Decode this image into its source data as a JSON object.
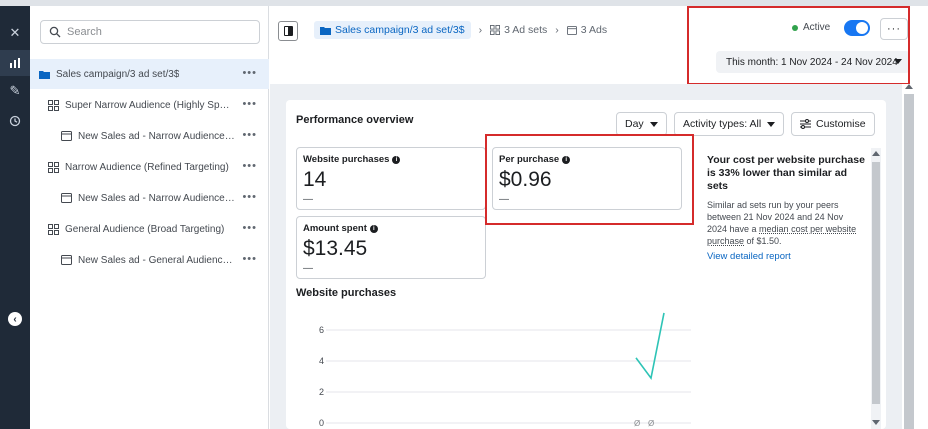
{
  "search": {
    "placeholder": "Search"
  },
  "tree": [
    {
      "label": "Sales campaign/3 ad set/3$",
      "type": "campaign",
      "selected": true
    },
    {
      "label": "Super Narrow Audience (Highly Specifi...",
      "type": "adset"
    },
    {
      "label": "New Sales ad - Narrow Audience (R...",
      "type": "ad"
    },
    {
      "label": "Narrow Audience (Refined Targeting)",
      "type": "adset"
    },
    {
      "label": "New Sales ad - Narrow Audience (R...",
      "type": "ad"
    },
    {
      "label": "General Audience (Broad Targeting)",
      "type": "adset"
    },
    {
      "label": "New Sales ad - General Audience (B...",
      "type": "ad"
    }
  ],
  "header": {
    "breadcrumb": [
      {
        "label": "Sales campaign/3 ad set/3$",
        "icon": "folder-icon"
      },
      {
        "label": "3 Ad sets",
        "icon": "adsets-icon"
      },
      {
        "label": "3 Ads",
        "icon": "ad-icon"
      }
    ],
    "status": "Active",
    "more": "···",
    "date_range": "This month: 1 Nov 2024 - 24 Nov 2024"
  },
  "performance": {
    "title": "Performance overview",
    "granularity": "Day",
    "activity": "Activity types: All",
    "customise": "Customise",
    "metrics": [
      {
        "label": "Website purchases",
        "value": "14",
        "delta": "—"
      },
      {
        "label": "Per purchase",
        "value": "$0.96",
        "delta": "—"
      },
      {
        "label": "Amount spent",
        "value": "$13.45",
        "delta": "—"
      }
    ],
    "insight": {
      "headline": "Your cost per website purchase is 33% lower than similar ad sets",
      "body_start": "Similar ad sets run by your peers between 21 Nov 2024 and 24 Nov 2024 have a ",
      "body_link": "median cost per website purchase",
      "body_end": " of $1.50.",
      "link": "View detailed report"
    }
  },
  "chart_data": {
    "type": "line",
    "title": "Website purchases",
    "yticks": [
      0,
      2,
      4,
      6
    ],
    "ylim": [
      0,
      7
    ],
    "series": [
      {
        "name": "",
        "values": [
          4.2,
          2.9,
          7.1
        ]
      }
    ]
  },
  "colors": {
    "accent": "#1877f2",
    "highlight": "#d52b2b",
    "line": "#2ec4b6",
    "rail": "#1f2a38"
  }
}
